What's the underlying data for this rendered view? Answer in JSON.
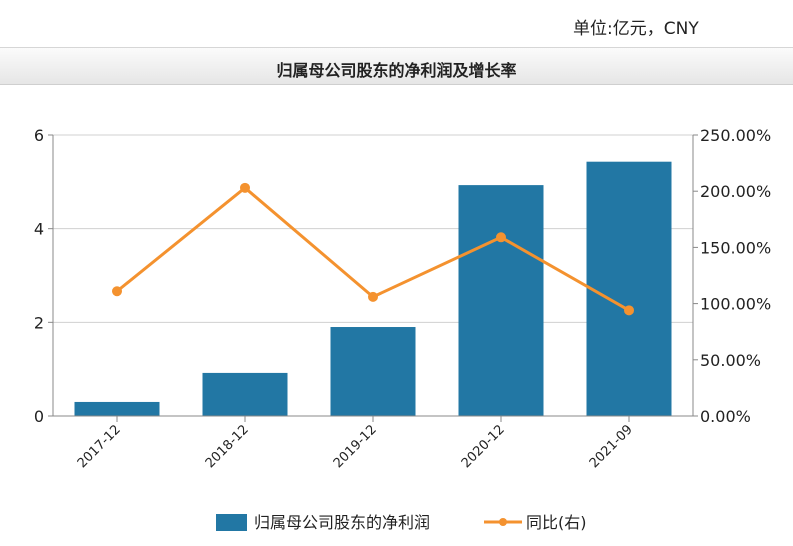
{
  "unit_label": "单位:亿元，CNY",
  "chart_data": {
    "type": "bar",
    "title": "归属母公司股东的净利润及增长率",
    "categories": [
      "2017-12",
      "2018-12",
      "2019-12",
      "2020-12",
      "2021-09"
    ],
    "series": [
      {
        "name": "归属母公司股东的净利润",
        "type": "bar",
        "axis": "left",
        "color": "#2277a4",
        "values": [
          0.3,
          0.92,
          1.9,
          4.93,
          5.43
        ]
      },
      {
        "name": "同比(右)",
        "type": "line",
        "axis": "right",
        "color": "#f4922f",
        "values": [
          111,
          203,
          106,
          159,
          94
        ]
      }
    ],
    "y_left": {
      "min": 0,
      "max": 6,
      "ticks": [
        "0",
        "2",
        "4",
        "6"
      ],
      "tick_values": [
        0,
        2,
        4,
        6
      ]
    },
    "y_right": {
      "min": 0,
      "max": 250,
      "ticks": [
        "0.00%",
        "50.00%",
        "100.00%",
        "150.00%",
        "200.00%",
        "250.00%"
      ],
      "tick_values": [
        0,
        50,
        100,
        150,
        200,
        250
      ]
    },
    "grid": true,
    "legend_position": "bottom"
  }
}
